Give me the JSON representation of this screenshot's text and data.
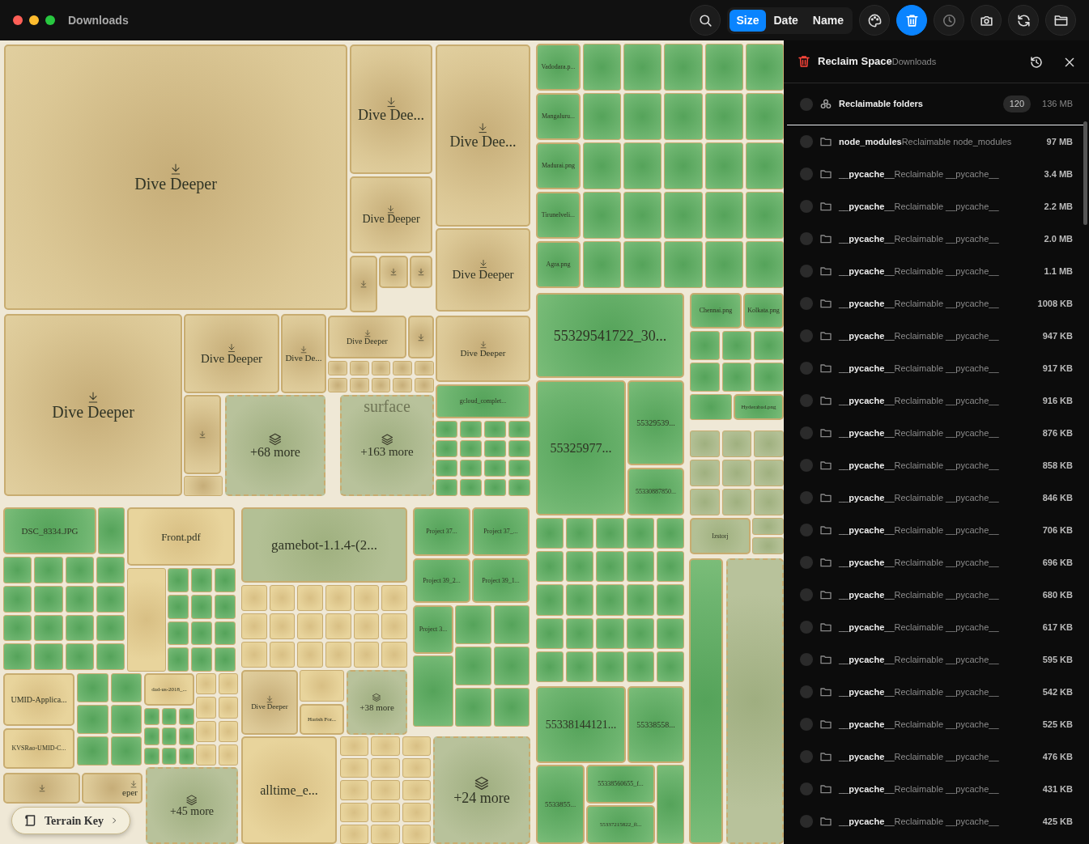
{
  "window": {
    "title": "Downloads"
  },
  "toolbar": {
    "search": {
      "selected": false
    },
    "sort_options": [
      {
        "label": "Size",
        "selected": true
      },
      {
        "label": "Date",
        "selected": false
      },
      {
        "label": "Name",
        "selected": false
      }
    ],
    "tools": [
      {
        "kind": "palette",
        "selected": false,
        "disabled": false
      },
      {
        "kind": "trash",
        "selected": true,
        "disabled": false
      },
      {
        "kind": "history",
        "selected": false,
        "disabled": true
      },
      {
        "kind": "camera",
        "selected": false,
        "disabled": false
      },
      {
        "kind": "refresh",
        "selected": false,
        "disabled": false
      },
      {
        "kind": "folder",
        "selected": false,
        "disabled": false
      }
    ]
  },
  "treemap": {
    "tiles": [
      {
        "kind": "folder",
        "label": "Dive Deeper"
      },
      {
        "kind": "folder",
        "label": "Dive Dee..."
      },
      {
        "kind": "folder",
        "label": "Dive Dee..."
      },
      {
        "kind": "folder",
        "label": "Dive Deeper"
      },
      {
        "kind": "folder",
        "label": "Dive Deeper"
      },
      {
        "kind": "folder"
      },
      {
        "kind": "folder"
      },
      {
        "kind": "folder"
      },
      {
        "kind": "folder",
        "label": "Dive Deeper"
      },
      {
        "kind": "folder",
        "label": "Dive Deeper"
      },
      {
        "kind": "folder",
        "label": "Dive De..."
      },
      {
        "kind": "folder",
        "label": "Dive Deeper"
      },
      {
        "kind": "folder"
      },
      {
        "kind": "folder",
        "label": "Dive Deeper"
      },
      {
        "kind": "folder"
      },
      {
        "kind": "group",
        "label": "+68 more"
      },
      {
        "kind": "group",
        "label": "+163 more",
        "terrain_label": "surface"
      },
      {
        "kind": "file",
        "label": "gcloud_complet..."
      },
      {
        "kind": "file",
        "label": "Vadodara.p..."
      },
      {
        "kind": "file",
        "label": "Mangaluru..."
      },
      {
        "kind": "file",
        "label": "Madurai.png"
      },
      {
        "kind": "file",
        "label": "Tirunelveli..."
      },
      {
        "kind": "file",
        "label": "Agra.png"
      },
      {
        "kind": "file",
        "label": "55329541722_30..."
      },
      {
        "kind": "file",
        "label": "55325977..."
      },
      {
        "kind": "file",
        "label": "55329539..."
      },
      {
        "kind": "file",
        "label": "55330887850..."
      },
      {
        "kind": "file",
        "label": "Chennai.png"
      },
      {
        "kind": "file",
        "label": "Kolkata.png"
      },
      {
        "kind": "file",
        "label": "Hyderabad.png"
      },
      {
        "kind": "archive",
        "label": "Izstorj"
      },
      {
        "kind": "file"
      },
      {
        "kind": "group"
      },
      {
        "kind": "file",
        "label": "55338144121..."
      },
      {
        "kind": "file",
        "label": "55338558..."
      },
      {
        "kind": "file",
        "label": "5533855..."
      },
      {
        "kind": "file",
        "label": "55338560655_f..."
      },
      {
        "kind": "file",
        "label": "55337215822_fl..."
      },
      {
        "kind": "file",
        "label": "DSC_8334.JPG"
      },
      {
        "kind": "doc",
        "label": "Front.pdf"
      },
      {
        "kind": "archive",
        "label": "gamebot-1.1.4-(2..."
      },
      {
        "kind": "folder",
        "label": "Dive Deeper"
      },
      {
        "kind": "doc",
        "label": "Harish For..."
      },
      {
        "kind": "group",
        "label": "+38 more"
      },
      {
        "kind": "file",
        "label": "Project 37..."
      },
      {
        "kind": "file",
        "label": "Project 37_..."
      },
      {
        "kind": "file",
        "label": "Project 39_2..."
      },
      {
        "kind": "file",
        "label": "Project 39_1..."
      },
      {
        "kind": "file",
        "label": "Project 3..."
      },
      {
        "kind": "doc",
        "label": "UMID-Applica..."
      },
      {
        "kind": "doc",
        "label": "KVSRao-UMID-C..."
      },
      {
        "kind": "doc",
        "label": "dad-us-2018_..."
      },
      {
        "kind": "folder"
      },
      {
        "kind": "folder",
        "label": "eper"
      },
      {
        "kind": "group",
        "label": "+45 more"
      },
      {
        "kind": "doc",
        "label": "alltime_e..."
      },
      {
        "kind": "group",
        "label": "+24 more"
      }
    ],
    "terrain_key": {
      "label": "Terrain Key"
    }
  },
  "panel": {
    "title": "Reclaim Space",
    "subtitle": "Downloads",
    "summary": {
      "label": "Reclaimable folders",
      "count": "120",
      "size": "136 MB",
      "checked": false
    },
    "items": [
      {
        "name": "node_modules",
        "description": "Reclaimable node_modules",
        "size": "97 MB",
        "checked": false
      },
      {
        "name": "__pycache__",
        "description": "Reclaimable __pycache__",
        "size": "3.4 MB",
        "checked": false
      },
      {
        "name": "__pycache__",
        "description": "Reclaimable __pycache__",
        "size": "2.2 MB",
        "checked": false
      },
      {
        "name": "__pycache__",
        "description": "Reclaimable __pycache__",
        "size": "2.0 MB",
        "checked": false
      },
      {
        "name": "__pycache__",
        "description": "Reclaimable __pycache__",
        "size": "1.1 MB",
        "checked": false
      },
      {
        "name": "__pycache__",
        "description": "Reclaimable __pycache__",
        "size": "1008 KB",
        "checked": false
      },
      {
        "name": "__pycache__",
        "description": "Reclaimable __pycache__",
        "size": "947 KB",
        "checked": false
      },
      {
        "name": "__pycache__",
        "description": "Reclaimable __pycache__",
        "size": "917 KB",
        "checked": false
      },
      {
        "name": "__pycache__",
        "description": "Reclaimable __pycache__",
        "size": "916 KB",
        "checked": false
      },
      {
        "name": "__pycache__",
        "description": "Reclaimable __pycache__",
        "size": "876 KB",
        "checked": false
      },
      {
        "name": "__pycache__",
        "description": "Reclaimable __pycache__",
        "size": "858 KB",
        "checked": false
      },
      {
        "name": "__pycache__",
        "description": "Reclaimable __pycache__",
        "size": "846 KB",
        "checked": false
      },
      {
        "name": "__pycache__",
        "description": "Reclaimable __pycache__",
        "size": "706 KB",
        "checked": false
      },
      {
        "name": "__pycache__",
        "description": "Reclaimable __pycache__",
        "size": "696 KB",
        "checked": false
      },
      {
        "name": "__pycache__",
        "description": "Reclaimable __pycache__",
        "size": "680 KB",
        "checked": false
      },
      {
        "name": "__pycache__",
        "description": "Reclaimable __pycache__",
        "size": "617 KB",
        "checked": false
      },
      {
        "name": "__pycache__",
        "description": "Reclaimable __pycache__",
        "size": "595 KB",
        "checked": false
      },
      {
        "name": "__pycache__",
        "description": "Reclaimable __pycache__",
        "size": "542 KB",
        "checked": false
      },
      {
        "name": "__pycache__",
        "description": "Reclaimable __pycache__",
        "size": "525 KB",
        "checked": false
      },
      {
        "name": "__pycache__",
        "description": "Reclaimable __pycache__",
        "size": "476 KB",
        "checked": false
      },
      {
        "name": "__pycache__",
        "description": "Reclaimable __pycache__",
        "size": "431 KB",
        "checked": false
      },
      {
        "name": "__pycache__",
        "description": "Reclaimable __pycache__",
        "size": "425 KB",
        "checked": false
      }
    ]
  }
}
